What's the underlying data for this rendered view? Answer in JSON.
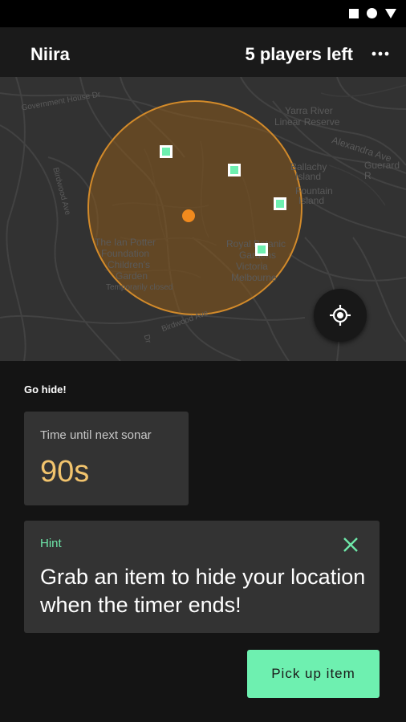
{
  "status_bar": {
    "icons": [
      "square-icon",
      "circle-icon",
      "triangle-icon"
    ]
  },
  "app_bar": {
    "title": "Niira",
    "players_left": "5 players left",
    "menu_icon": "more-horizontal-icon"
  },
  "map": {
    "labels": [
      "Yarra River",
      "Linear Reserve",
      "Alexandra Ave",
      "Guerard R",
      "Ballachy",
      "Island",
      "Fountain",
      "Island",
      "The Ian Potter",
      "Foundation",
      "Children's",
      "Garden",
      "Temporarily closed",
      "Royal Botanic",
      "Gardens",
      "Victoria",
      "Melbourne",
      "Birdwood Ave",
      "Birdwood Ave",
      "Government House Dr",
      "Dr"
    ],
    "locate_icon": "my-location-icon"
  },
  "status_message": "Go hide!",
  "sonar": {
    "label": "Time until next sonar",
    "value": "90s"
  },
  "hint": {
    "label": "Hint",
    "text": "Grab an item to hide your location when the timer ends!",
    "close_icon": "close-icon"
  },
  "actions": {
    "pickup_label": "Pick up item"
  },
  "colors": {
    "accent_green": "#6ef0b0",
    "sonar_orange": "#d28a2a",
    "timer_yellow": "#f2c46d",
    "player_dot": "#f08a1e"
  }
}
